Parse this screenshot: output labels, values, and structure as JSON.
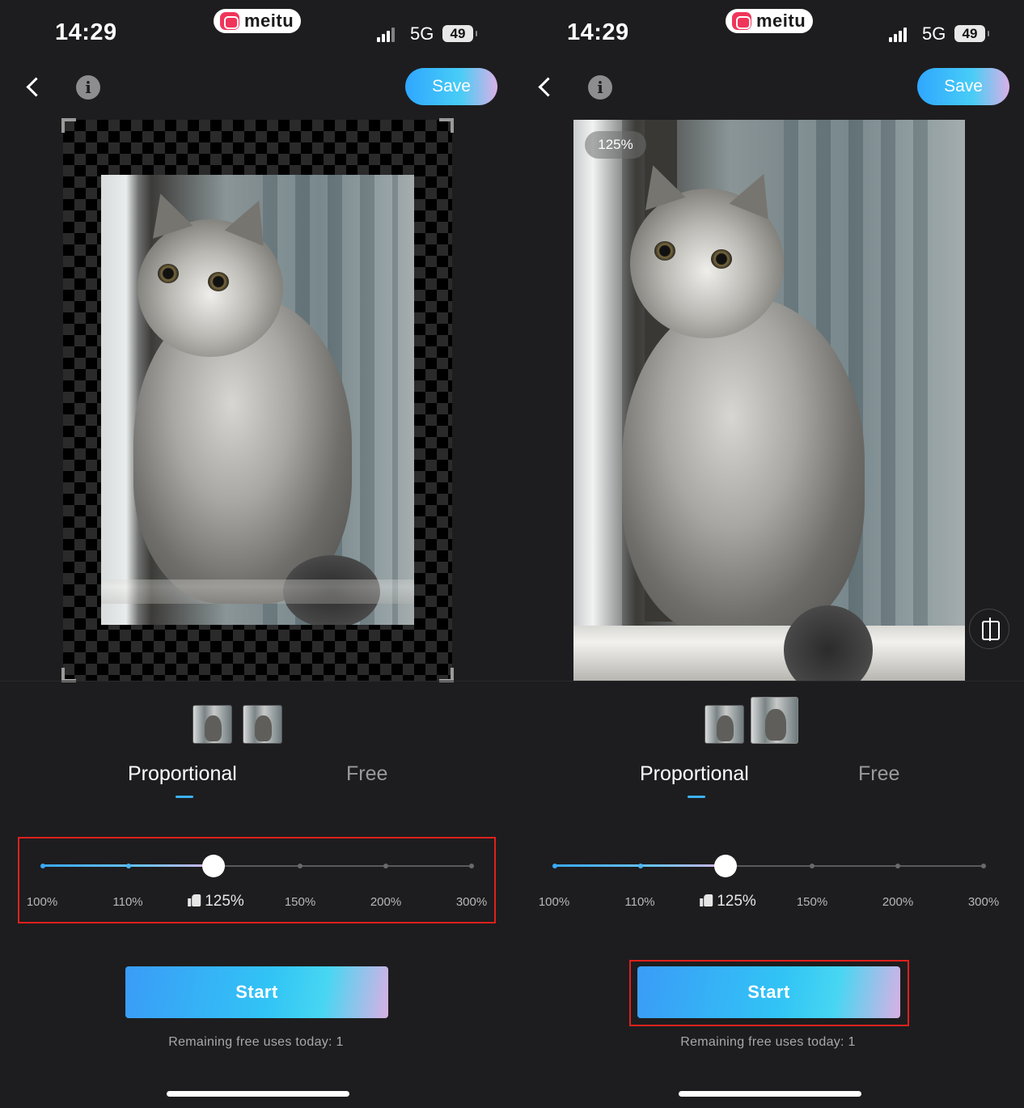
{
  "status_bar": {
    "time": "14:29",
    "app_badge": "meitu",
    "network": "5G",
    "battery": "49"
  },
  "toolbar": {
    "save_label": "Save"
  },
  "preview": {
    "zoom_badge": "125%"
  },
  "tabs": [
    {
      "label": "Proportional",
      "active": true
    },
    {
      "label": "Free",
      "active": false
    }
  ],
  "slider": {
    "ticks": [
      "100%",
      "110%",
      "125%",
      "150%",
      "200%",
      "300%"
    ],
    "selected": "125%",
    "selected_index": 2,
    "recommended": "125%"
  },
  "actions": {
    "start_label": "Start",
    "remaining_text": "Remaining free uses today: 1"
  },
  "colors": {
    "accent_blue": "#3bb2f5",
    "highlight_red": "#e0201c",
    "background": "#1d1d1f"
  },
  "icons": [
    "back-chevron-icon",
    "info-icon",
    "compare-icon",
    "thumbs-up-icon",
    "signal-icon",
    "battery-icon"
  ]
}
